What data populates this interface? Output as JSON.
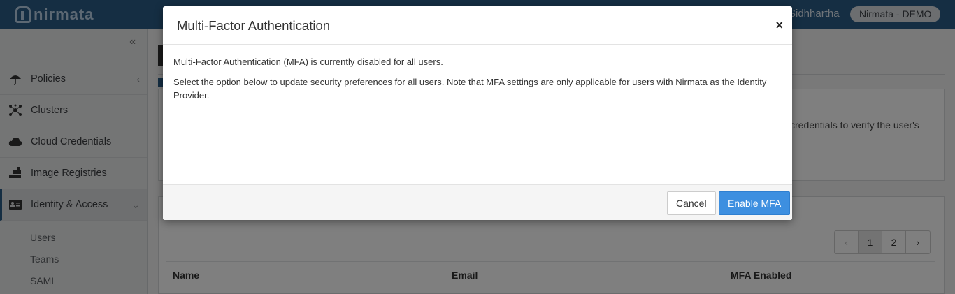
{
  "app": {
    "logo_text": "nirmata",
    "user_name": "Sidhhartha",
    "org_name": "Nirmata - DEMO"
  },
  "sidebar": {
    "collapse_icon": "double-chevron-left-icon",
    "items": [
      {
        "label": "Policies",
        "icon": "umbrella-icon"
      },
      {
        "label": "Clusters",
        "icon": "cluster-icon"
      },
      {
        "label": "Cloud Credentials",
        "icon": "cloud-icon"
      },
      {
        "label": "Image Registries",
        "icon": "registry-icon"
      },
      {
        "label": "Identity & Access",
        "icon": "id-card-icon"
      }
    ],
    "sub_items": [
      "Users",
      "Teams",
      "SAML"
    ]
  },
  "main": {
    "info_text": "credentials to verify the user's",
    "pagination": {
      "prev": "‹",
      "pages": [
        "1",
        "2"
      ],
      "next": "›",
      "current": "1"
    },
    "table_headers": [
      "Name",
      "Email",
      "MFA Enabled"
    ]
  },
  "modal": {
    "title": "Multi-Factor Authentication",
    "close_label": "×",
    "body_line1": "Multi-Factor Authentication (MFA) is currently disabled for all users.",
    "body_line2": "Select the option below to update security preferences for all users. Note that MFA settings are only applicable for users with Nirmata as the Identity Provider.",
    "cancel_label": "Cancel",
    "enable_label": "Enable MFA"
  },
  "colors": {
    "topbar": "#2b5c86",
    "primary_button": "#3d8fe0"
  }
}
